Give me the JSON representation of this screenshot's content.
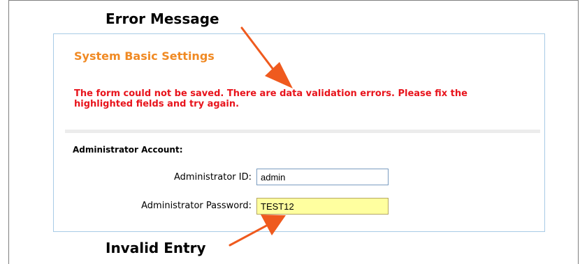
{
  "annotations": {
    "top_label": "Error Message",
    "bottom_label": "Invalid Entry",
    "arrow_color": "#ef5a1e"
  },
  "panel": {
    "title": "System Basic Settings",
    "title_color": "#f08a24",
    "error_message": "The form could not be saved. There are data validation errors. Please fix the highlighted fields and try again.",
    "error_color": "#e8141c",
    "section_label": "Administrator Account:",
    "fields": {
      "admin_id": {
        "label": "Administrator ID:",
        "value": "admin"
      },
      "admin_password": {
        "label": "Administrator Password:",
        "value": "TEST12",
        "highlight_color": "#ffff9f"
      }
    }
  }
}
